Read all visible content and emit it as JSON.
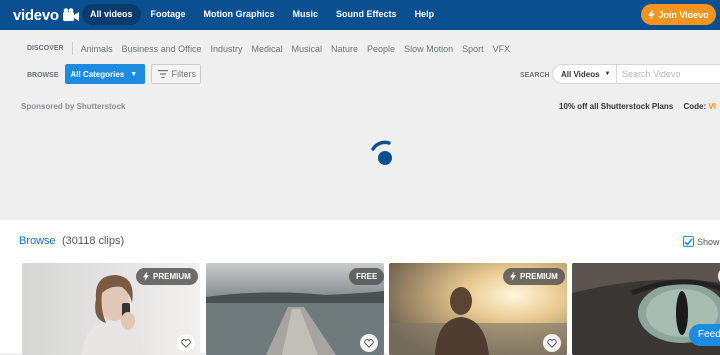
{
  "header": {
    "logo_text": "videvo",
    "nav": [
      {
        "label": "All videos",
        "active": true
      },
      {
        "label": "Footage",
        "active": false
      },
      {
        "label": "Motion Graphics",
        "active": false
      },
      {
        "label": "Music",
        "active": false
      },
      {
        "label": "Sound Effects",
        "active": false
      },
      {
        "label": "Help",
        "active": false
      }
    ],
    "join_label": "Join Videvo"
  },
  "discover": {
    "label": "DISCOVER",
    "categories": [
      "Animals",
      "Business and Office",
      "Industry",
      "Medical",
      "Musical",
      "Nature",
      "People",
      "Slow Motion",
      "Sport",
      "VFX"
    ]
  },
  "browse_bar": {
    "label": "BROWSE",
    "categories_button": "All Categories",
    "filters_button": "Filters"
  },
  "search": {
    "label": "SEARCH",
    "type_selected": "All Videos",
    "placeholder": "Search Videvo"
  },
  "sponsor": {
    "text": "Sponsored by Shutterstock",
    "promo_text": "10% off all Shutterstock Plans",
    "code_label": "Code:",
    "code_value": "VI"
  },
  "results": {
    "title": "Browse",
    "count_text": "(30118 clips)",
    "show_label": "Show",
    "show_checked": true
  },
  "clips": [
    {
      "badge": "PREMIUM"
    },
    {
      "badge": "FREE"
    },
    {
      "badge": "PREMIUM"
    },
    {
      "badge": ""
    }
  ],
  "feedback_label": "Feed",
  "colors": {
    "header_bg": "#0a4f8f",
    "accent_orange": "#f7941d",
    "accent_blue": "#1d8ce0",
    "page_bg": "#efeff0"
  }
}
